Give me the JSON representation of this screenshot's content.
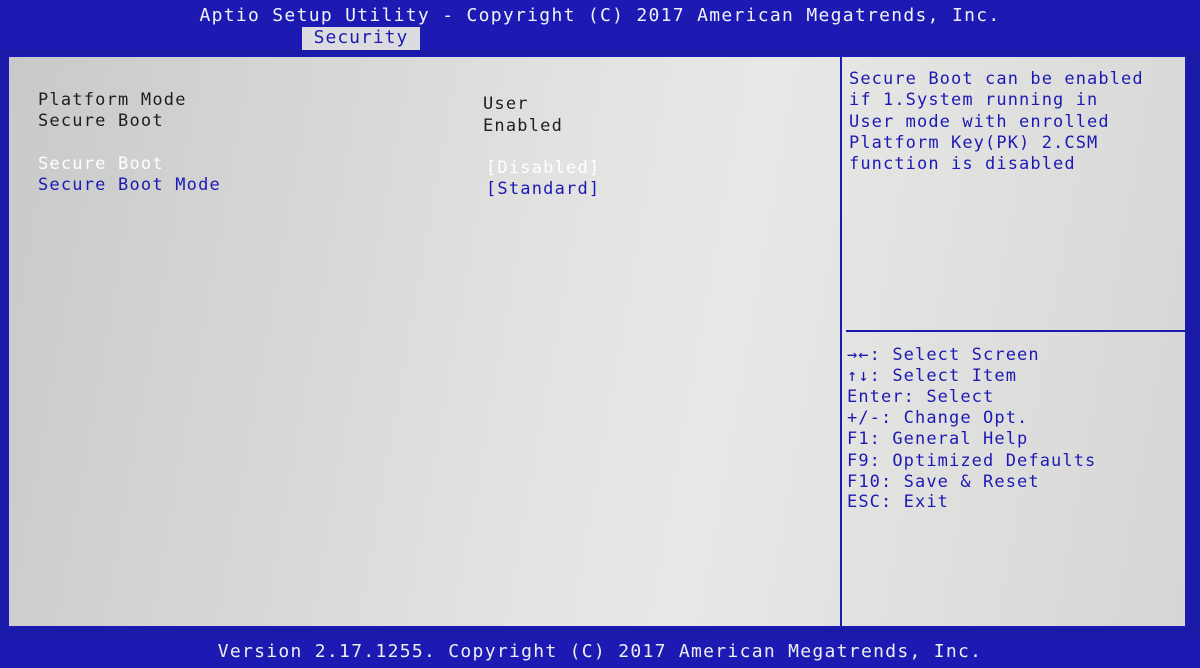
{
  "header": {
    "title": "Aptio Setup Utility - Copyright (C) 2017 American Megatrends, Inc.",
    "active_tab": "Security"
  },
  "main": {
    "info_rows": [
      {
        "label": "Platform Mode",
        "value": "User"
      },
      {
        "label": "Secure Boot",
        "value": "Enabled"
      }
    ],
    "settings": [
      {
        "label": "Secure Boot",
        "value": "[Disabled]",
        "selected": true
      },
      {
        "label": "Secure Boot Mode",
        "value": "[Standard]",
        "selected": false
      }
    ]
  },
  "help": {
    "lines": [
      "Secure Boot can be enabled",
      "if 1.System running in",
      "User mode with enrolled",
      "Platform Key(PK) 2.CSM",
      "function is disabled"
    ]
  },
  "keys": [
    "→←: Select Screen",
    "↑↓: Select Item",
    "Enter: Select",
    "+/-: Change Opt.",
    "F1: General Help",
    "F9: Optimized Defaults",
    "F10: Save & Reset",
    "ESC: Exit"
  ],
  "footer": {
    "text": "Version 2.17.1255. Copyright (C) 2017 American Megatrends, Inc."
  },
  "colors": {
    "bios_blue": "#1c1ab2",
    "panel_gray": "#e0e0de",
    "selected_text": "#ffffff"
  }
}
